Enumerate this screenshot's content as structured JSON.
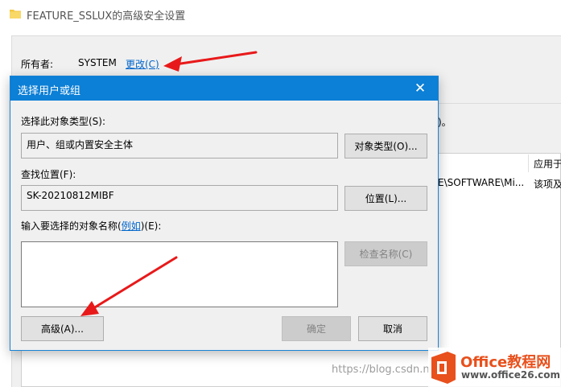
{
  "background_window": {
    "title": "FEATURE_SSLUX的高级安全设置",
    "owner_label": "所有者:",
    "owner_value": "SYSTEM",
    "change_link": "更改(C)",
    "right_fragment": ")。",
    "column_header_apply": "应用于",
    "row_path_fragment": "E\\SOFTWARE\\Mi...",
    "row_apply_fragment": "该项及"
  },
  "dialog": {
    "title": "选择用户或组",
    "object_types_label": "选择此对象类型(S):",
    "object_types_value": "用户、组或内置安全主体",
    "object_types_button": "对象类型(O)...",
    "location_label": "查找位置(F):",
    "location_value": "SK-20210812MIBF",
    "location_button": "位置(L)...",
    "names_label_prefix": "输入要选择的对象名称(",
    "names_label_link": "例如",
    "names_label_suffix": ")(E):",
    "names_value": "",
    "check_names_button": "检查名称(C)",
    "advanced_button": "高级(A)...",
    "ok_button": "确定",
    "cancel_button": "取消"
  },
  "watermark": {
    "url_text": "https://blog.csdn.n",
    "logo_title": "Office教程网",
    "logo_url": "www.office26.com"
  },
  "colors": {
    "titlebar_blue": "#0c7fd6",
    "link_blue": "#0066cc",
    "arrow_red": "#e8191a",
    "logo_orange": "#e8501c"
  }
}
